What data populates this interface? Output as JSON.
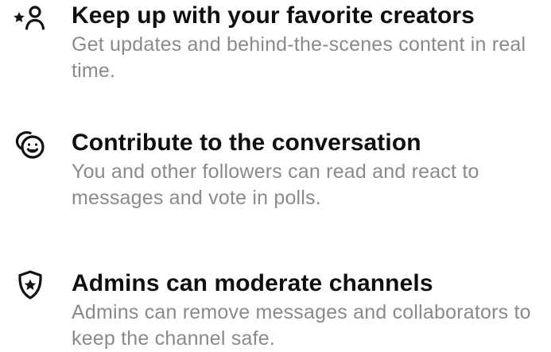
{
  "features": [
    {
      "icon": "star-person-icon",
      "title": "Keep up with your favorite creators",
      "description": "Get updates and behind-the-scenes content in real time."
    },
    {
      "icon": "smiley-chat-icon",
      "title": "Contribute to the conversation",
      "description": "You and other followers can read and react to messages and vote in polls."
    },
    {
      "icon": "shield-star-icon",
      "title": "Admins can moderate channels",
      "description": "Admins can remove messages and collaborators to keep the channel safe."
    }
  ],
  "colors": {
    "title": "#0f0f0f",
    "description": "#8a8a8a",
    "background": "#ffffff"
  }
}
